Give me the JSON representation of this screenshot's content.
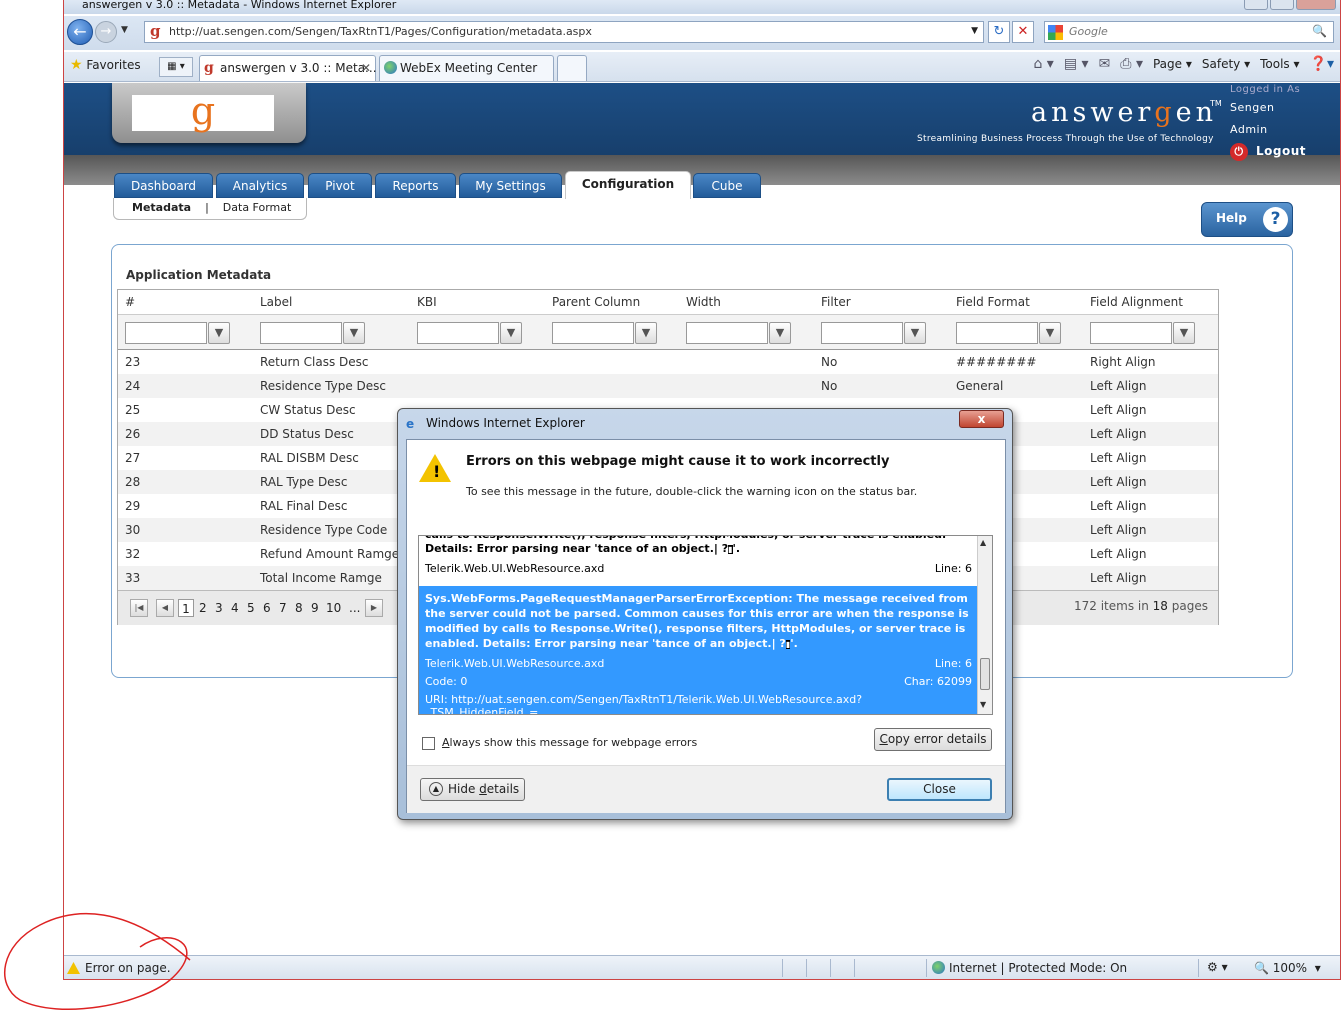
{
  "browser": {
    "title": "answergen v 3.0 :: Metadata - Windows Internet Explorer",
    "url": "http://uat.sengen.com/Sengen/TaxRtnT1/Pages/Configuration/metadata.aspx",
    "search_placeholder": "Google",
    "favorites_label": "Favorites",
    "tabs": [
      {
        "label": "answergen v 3.0 :: Meta..."
      },
      {
        "label": "WebEx Meeting Center"
      }
    ],
    "command_bar": [
      "Page",
      "Safety",
      "Tools"
    ]
  },
  "header": {
    "logo_letter": "g",
    "brand_pre": "answer",
    "brand_g": "g",
    "brand_post": "en",
    "trademark": "TM",
    "tagline": "Streamlining Business Process Through the Use of Technology",
    "logged_in_label": "Logged in As",
    "username": "Sengen",
    "role": "Admin",
    "logout_label": "Logout"
  },
  "nav": {
    "tabs": [
      "Dashboard",
      "Analytics",
      "Pivot",
      "Reports",
      "My Settings",
      "Configuration",
      "Cube"
    ],
    "active": "Configuration",
    "subnav": [
      "Metadata",
      "|",
      "Data Format"
    ],
    "help_label": "Help"
  },
  "panel": {
    "title": "Application Metadata",
    "columns": [
      "#",
      "Label",
      "KBI",
      "Parent Column",
      "Width",
      "Filter",
      "Field Format",
      "Field Alignment"
    ],
    "rows": [
      {
        "num": "23",
        "label": "Return Class Desc",
        "filter": "No",
        "format": "########",
        "align": "Right Align"
      },
      {
        "num": "24",
        "label": "Residence Type Desc",
        "filter": "No",
        "format": "General",
        "align": "Left Align"
      },
      {
        "num": "25",
        "label": "CW Status Desc",
        "filter": "",
        "format": "",
        "align": "Left Align"
      },
      {
        "num": "26",
        "label": "DD Status Desc",
        "filter": "",
        "format": "",
        "align": "Left Align"
      },
      {
        "num": "27",
        "label": "RAL DISBM Desc",
        "filter": "",
        "format": "",
        "align": "Left Align"
      },
      {
        "num": "28",
        "label": "RAL Type Desc",
        "filter": "",
        "format": "",
        "align": "Left Align"
      },
      {
        "num": "29",
        "label": "RAL Final Desc",
        "filter": "",
        "format": "",
        "align": "Left Align"
      },
      {
        "num": "30",
        "label": "Residence Type Code",
        "filter": "",
        "format": "",
        "align": "Left Align"
      },
      {
        "num": "32",
        "label": "Refund Amount Ramge",
        "filter": "",
        "format": "",
        "align": "Left Align"
      },
      {
        "num": "33",
        "label": "Total Income Ramge",
        "filter": "",
        "format": "",
        "align": "Left Align"
      }
    ],
    "pager": {
      "pages": [
        "1",
        "2",
        "3",
        "4",
        "5",
        "6",
        "7",
        "8",
        "9",
        "10",
        "..."
      ],
      "items_count": "172",
      "items_label": "items in",
      "pages_count": "18",
      "pages_label": "pages"
    }
  },
  "statusbar": {
    "error_text": "Error on page.",
    "zone": "Internet | Protected Mode: On",
    "zoom": "100%"
  },
  "dialog": {
    "title": "Windows Internet Explorer",
    "close_x": "x",
    "heading": "Errors on this webpage might cause it to work incorrectly",
    "subtext": "To see this message in the future, double-click the warning icon on the status bar.",
    "prev_error": {
      "msg": "calls to Response.Write(), response filters, HttpModules, or server trace is enabled. Details: Error parsing near 'tance of an object.|   ?",
      "msg_end": "'.",
      "source": "Telerik.Web.UI.WebResource.axd",
      "line": "Line: 6"
    },
    "selected_error": {
      "msg": "Sys.WebForms.PageRequestManagerParserErrorException: The message received from the server could not be parsed. Common causes for this error are when the response is modified by calls to Response.Write(), response filters, HttpModules, or server trace is enabled. Details: Error parsing near 'tance of an object.|   ?",
      "msg_end": "'.",
      "source": "Telerik.Web.UI.WebResource.axd",
      "line": "Line: 6",
      "code": "Code: 0",
      "char": "Char: 62099",
      "uri": "URI: http://uat.sengen.com/Sengen/TaxRtnT1/Telerik.Web.UI.WebResource.axd?_TSM_HiddenField_=..."
    },
    "always_show_a": "A",
    "always_show_rest": "lways show this message for webpage errors",
    "copy_c": "C",
    "copy_rest": "opy error details",
    "hide_pre": "Hide ",
    "hide_d": "d",
    "hide_post": "etails",
    "close_label": "Close"
  }
}
